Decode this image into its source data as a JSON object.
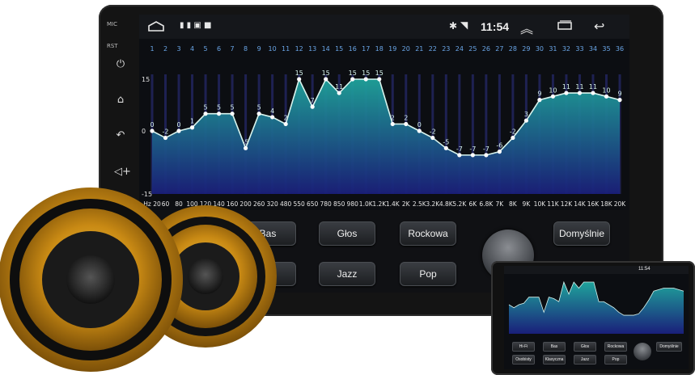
{
  "side": {
    "mic": "MIC",
    "rst": "RST"
  },
  "status": {
    "time": "11:54"
  },
  "eq": {
    "band_numbers": [
      "1",
      "2",
      "3",
      "4",
      "5",
      "6",
      "7",
      "8",
      "9",
      "10",
      "11",
      "12",
      "13",
      "14",
      "15",
      "16",
      "17",
      "18",
      "19",
      "20",
      "21",
      "22",
      "23",
      "24",
      "25",
      "26",
      "27",
      "28",
      "29",
      "30",
      "31",
      "32",
      "33",
      "34",
      "35",
      "36"
    ],
    "values": [
      0,
      -2,
      0,
      1,
      5,
      5,
      5,
      -5,
      5,
      4,
      2,
      15,
      7,
      15,
      11,
      15,
      15,
      15,
      2,
      2,
      0,
      -2,
      -5,
      -7,
      -7,
      -7,
      -6,
      -2,
      3,
      9,
      10,
      11,
      11,
      11,
      10,
      9
    ],
    "frequencies": [
      "Hz 20",
      "60",
      "80",
      "100",
      "120",
      "140",
      "160",
      "200",
      "260",
      "320",
      "480",
      "550",
      "650",
      "780",
      "850",
      "980",
      "1.0K",
      "1.2K",
      "1.4K",
      "2K",
      "2.5K",
      "3.2K",
      "4.8K",
      "5.2K",
      "6K",
      "6.8K",
      "7K",
      "8K",
      "9K",
      "10K",
      "11K",
      "12K",
      "14K",
      "16K",
      "18K",
      "20K"
    ],
    "y_labels": {
      "top": "15",
      "mid": "0",
      "bottom": "-15"
    },
    "ylim": [
      -15,
      15
    ],
    "colors": {
      "line": "#d8f4ee",
      "fill_top": "#1fa39b",
      "fill_bottom": "#1a1f7a",
      "label": "#6aa6e8",
      "bar": "#262a6e"
    }
  },
  "presets": {
    "bas": "Bas",
    "glos": "Głos",
    "rockowa": "Rockowa",
    "domyslnie": "Domyślnie",
    "klasyczna_partial": "zna",
    "jazz": "Jazz",
    "pop": "Pop"
  },
  "mini": {
    "time": "11:54",
    "buttons_row1": [
      "Hi-Fi",
      "Bas",
      "Głos",
      "Rockowa",
      "Domyślnie"
    ],
    "buttons_row2": [
      "Osobisty",
      "Klasyczna",
      "Jazz",
      "Pop"
    ]
  }
}
